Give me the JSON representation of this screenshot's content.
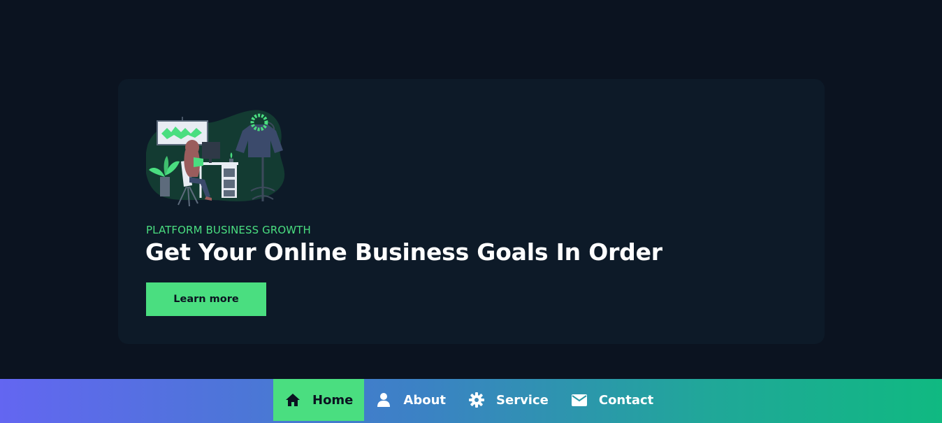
{
  "hero": {
    "eyebrow": "PLATFORM BUSINESS GROWTH",
    "headline": "Get Your Online Business Goals In Order",
    "cta_label": "Learn more",
    "illustration_icon": "woman-at-desk-illustration"
  },
  "nav": {
    "items": [
      {
        "label": "Home",
        "icon": "home-icon",
        "active": true
      },
      {
        "label": "About",
        "icon": "user-icon",
        "active": false
      },
      {
        "label": "Service",
        "icon": "gear-icon",
        "active": false
      },
      {
        "label": "Contact",
        "icon": "envelope-icon",
        "active": false
      }
    ]
  },
  "colors": {
    "background": "#0b1320",
    "card": "#0d1a28",
    "accent": "#4ade80",
    "nav_gradient_start": "#6366f1",
    "nav_gradient_end": "#10b981"
  }
}
